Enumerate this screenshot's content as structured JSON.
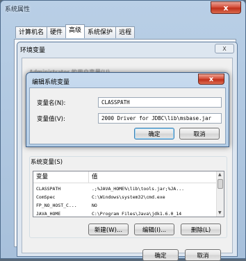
{
  "outer_window": {
    "title": "系统属性",
    "close_label": "x",
    "tabs": [
      "计算机名",
      "硬件",
      "高级",
      "系统保护",
      "远程"
    ],
    "active_tab": 2
  },
  "env_window": {
    "title": "环境变量",
    "close_label": "X",
    "user_vars_label": "Administrator 的用户变量(U)"
  },
  "edit_dialog": {
    "title": "编辑系统变量",
    "close_label": "x",
    "name_label": "变量名(N):",
    "name_value": "CLASSPATH",
    "value_label": "变量值(V):",
    "value_value": "2000 Driver for JDBC\\lib\\msbase.jar",
    "ok_label": "确定",
    "cancel_label": "取消"
  },
  "system_vars": {
    "label": "系统变量(S)",
    "columns": [
      "变量",
      "值"
    ],
    "rows": [
      {
        "name": "CLASSPATH",
        "value": ".;%JAVA_HOME%\\lib\\tools.jar;%JA..."
      },
      {
        "name": "ComSpec",
        "value": "C:\\Windows\\system32\\cmd.exe"
      },
      {
        "name": "FP_NO_HOST_C...",
        "value": "NO"
      },
      {
        "name": "JAVA_HOME",
        "value": "C:\\Program Files\\Java\\jdk1.6.0_14"
      }
    ],
    "new_label": "新建(W)...",
    "edit_label": "编辑(I)...",
    "delete_label": "删除(L)"
  },
  "footer": {
    "ok_label": "确定",
    "cancel_label": "取消"
  }
}
